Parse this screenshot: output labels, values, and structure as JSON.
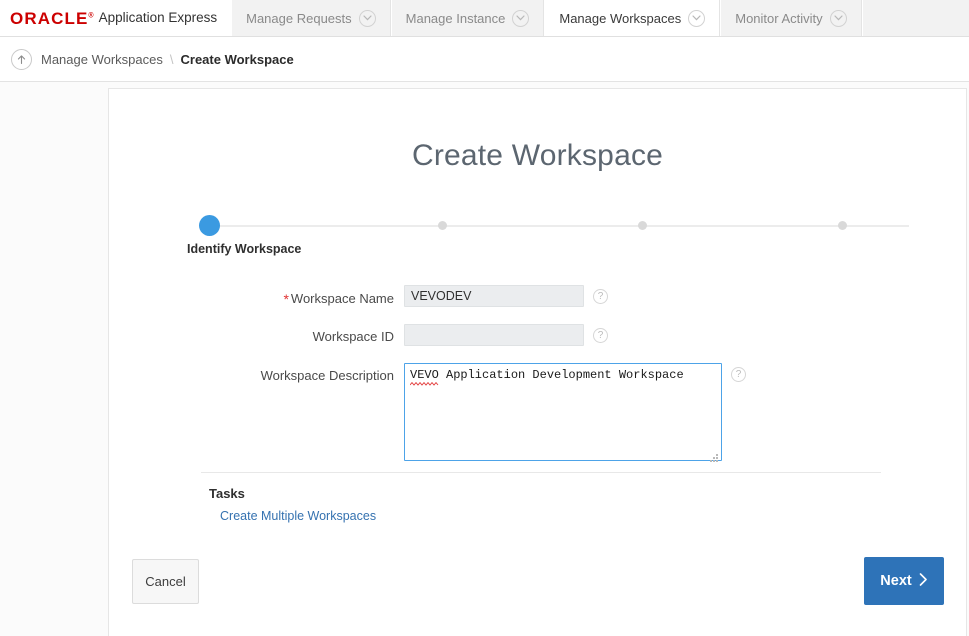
{
  "brand": {
    "logo_text": "ORACLE",
    "registered_mark": "®",
    "product": "Application Express",
    "logo_color": "#cc0000"
  },
  "topnav": {
    "tabs": [
      {
        "label": "Manage Requests",
        "icon": "chevron-down-icon",
        "active": false
      },
      {
        "label": "Manage Instance",
        "icon": "chevron-down-icon",
        "active": false
      },
      {
        "label": "Manage Workspaces",
        "icon": "chevron-down-icon",
        "active": true
      },
      {
        "label": "Monitor Activity",
        "icon": "chevron-down-icon",
        "active": false
      }
    ]
  },
  "breadcrumb": {
    "up_icon": "arrow-up-icon",
    "parent": "Manage Workspaces",
    "separator": "\\",
    "current": "Create Workspace"
  },
  "page": {
    "title": "Create Workspace"
  },
  "stepper": {
    "current_index": 0,
    "steps": [
      {
        "label": "Identify Workspace",
        "state": "current"
      },
      {
        "label": "",
        "state": "upcoming"
      },
      {
        "label": "",
        "state": "upcoming"
      },
      {
        "label": "",
        "state": "upcoming"
      }
    ],
    "active_color": "#3b9ae1",
    "inactive_color": "#d9d9d9"
  },
  "form": {
    "fields": [
      {
        "label": "Workspace Name",
        "required": true,
        "required_mark": "*",
        "value": "VEVODEV",
        "placeholder": "",
        "type": "text",
        "help_icon": "help-question-icon",
        "help_label": "?"
      },
      {
        "label": "Workspace ID",
        "required": false,
        "required_mark": "",
        "value": "",
        "placeholder": "",
        "type": "text",
        "help_icon": "help-question-icon",
        "help_label": "?"
      },
      {
        "label": "Workspace Description",
        "required": false,
        "required_mark": "",
        "value": "VEVO Application Development Workspace",
        "placeholder": "",
        "type": "textarea",
        "focused": true,
        "help_icon": "help-question-icon",
        "help_label": "?"
      }
    ]
  },
  "tasks": {
    "heading": "Tasks",
    "links": [
      {
        "label": "Create Multiple Workspaces"
      }
    ],
    "link_color": "#3572b0"
  },
  "footer": {
    "cancel_label": "Cancel",
    "next_label": "Next",
    "next_icon": "chevron-right-icon",
    "next_color": "#2e73b8"
  }
}
